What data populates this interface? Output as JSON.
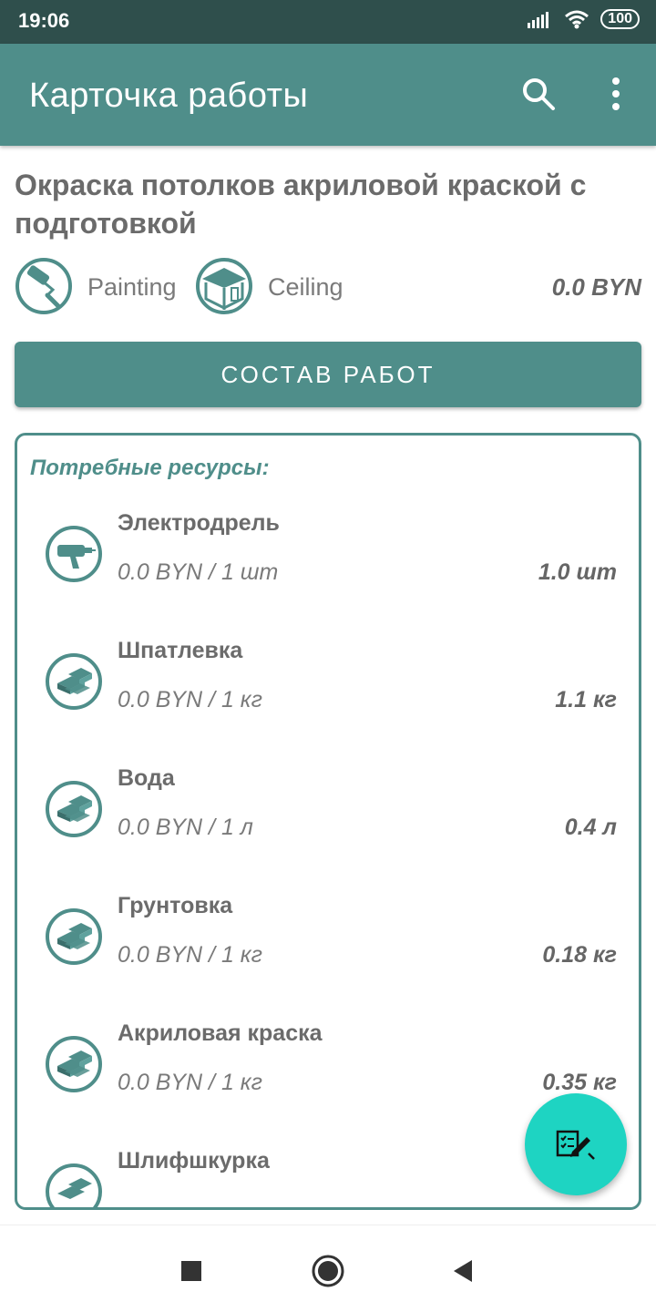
{
  "status_bar": {
    "time": "19:06",
    "battery": "100"
  },
  "app_bar": {
    "title": "Карточка работы",
    "icons": [
      "search-icon",
      "more-vert-icon"
    ]
  },
  "work": {
    "title": "Окраска потолков акриловой краской с подготовкой",
    "tags": [
      {
        "label": "Painting",
        "icon": "paint-roller-icon"
      },
      {
        "label": "Ceiling",
        "icon": "ceiling-room-icon"
      }
    ],
    "price": "0.0  BYN"
  },
  "compose_button": {
    "label": "СОСТАВ РАБОТ"
  },
  "resources": {
    "heading": "Потребные ресурсы:",
    "items": [
      {
        "name": "Электродрель",
        "price": "0.0 BYN / 1  шт",
        "qty": "1.0  шт",
        "icon": "drill-icon"
      },
      {
        "name": "Шпатлевка",
        "price": "0.0 BYN / 1  кг",
        "qty": "1.1  кг",
        "icon": "material-bricks-icon"
      },
      {
        "name": "Вода",
        "price": "0.0 BYN / 1  л",
        "qty": "0.4  л",
        "icon": "material-bricks-icon"
      },
      {
        "name": "Грунтовка",
        "price": "0.0 BYN / 1  кг",
        "qty": "0.18  кг",
        "icon": "material-bricks-icon"
      },
      {
        "name": "Акриловая краска",
        "price": "0.0 BYN / 1  кг",
        "qty": "0.35  кг",
        "icon": "material-bricks-icon"
      },
      {
        "name": "Шлифшкурка",
        "price": "",
        "qty": "",
        "icon": "material-bricks-icon"
      }
    ]
  },
  "fab": {
    "icon": "edit-checklist-icon"
  },
  "nav_bar": {
    "icons": [
      "recent-apps-icon",
      "home-icon",
      "back-icon"
    ]
  },
  "colors": {
    "primary": "#4f8e8a",
    "status_bar": "#2f4f4c",
    "fab": "#1ed4c2"
  }
}
